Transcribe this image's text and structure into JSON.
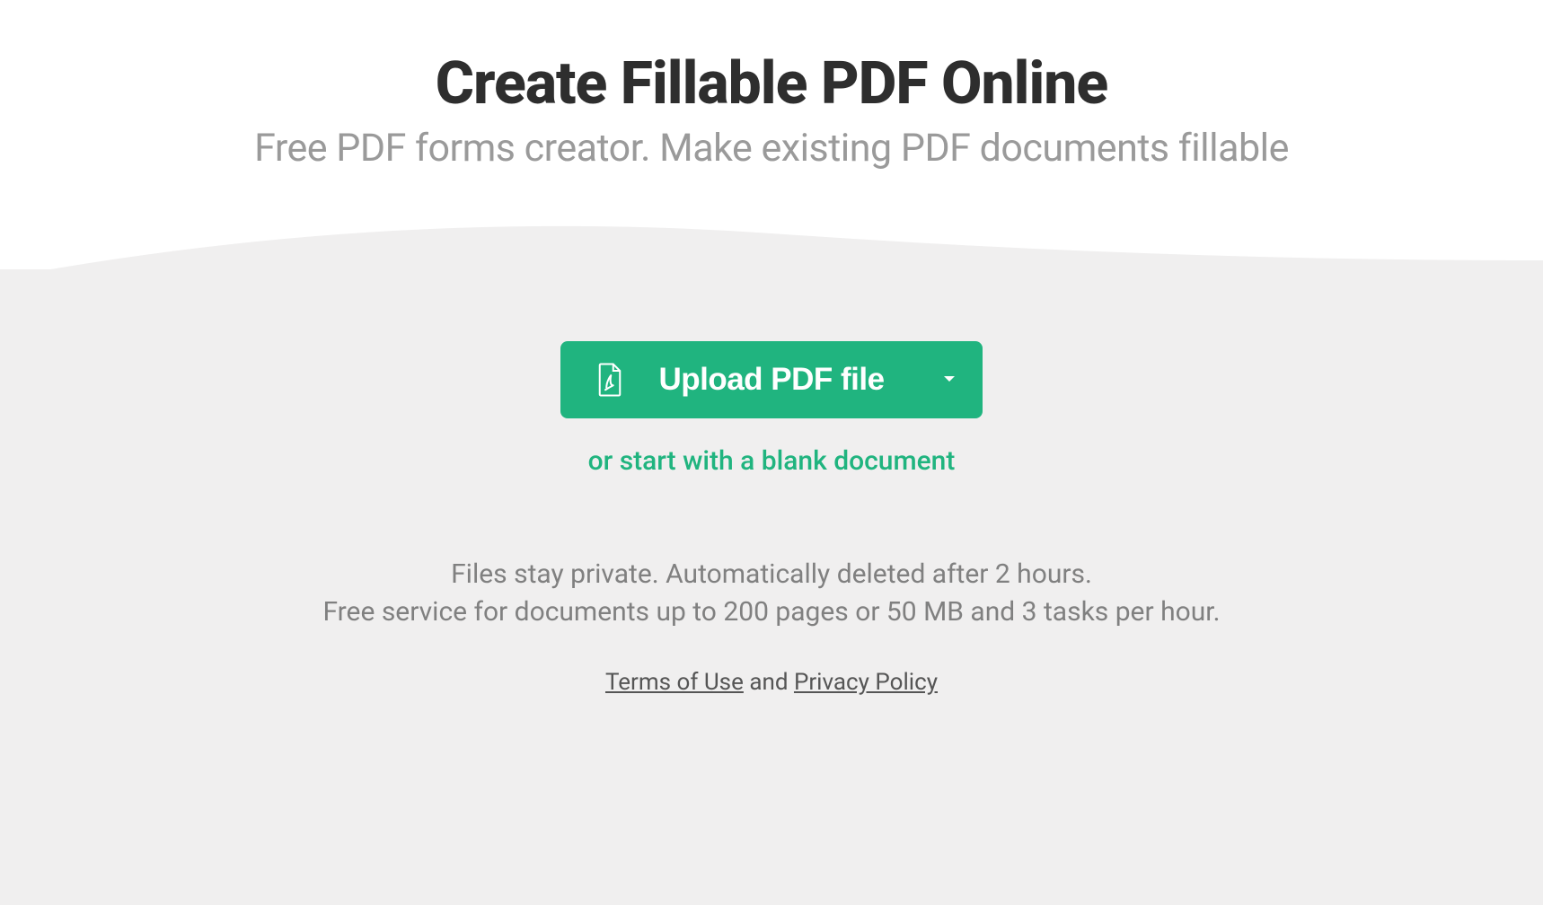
{
  "header": {
    "title": "Create Fillable PDF Online",
    "subtitle": "Free PDF forms creator. Make existing PDF documents fillable"
  },
  "upload": {
    "button_label": "Upload PDF file",
    "blank_link": "or start with a blank document"
  },
  "info": {
    "line1": "Files stay private. Automatically deleted after 2 hours.",
    "line2": "Free service for documents up to 200 pages or 50 MB and 3 tasks per hour."
  },
  "legal": {
    "terms": "Terms of Use",
    "separator": " and ",
    "privacy": "Privacy Policy"
  },
  "colors": {
    "accent": "#20b47f",
    "bg_light": "#ffffff",
    "bg_gray": "#f0efef",
    "text_dark": "#2e2e2e",
    "text_muted": "#9a9a9a"
  }
}
